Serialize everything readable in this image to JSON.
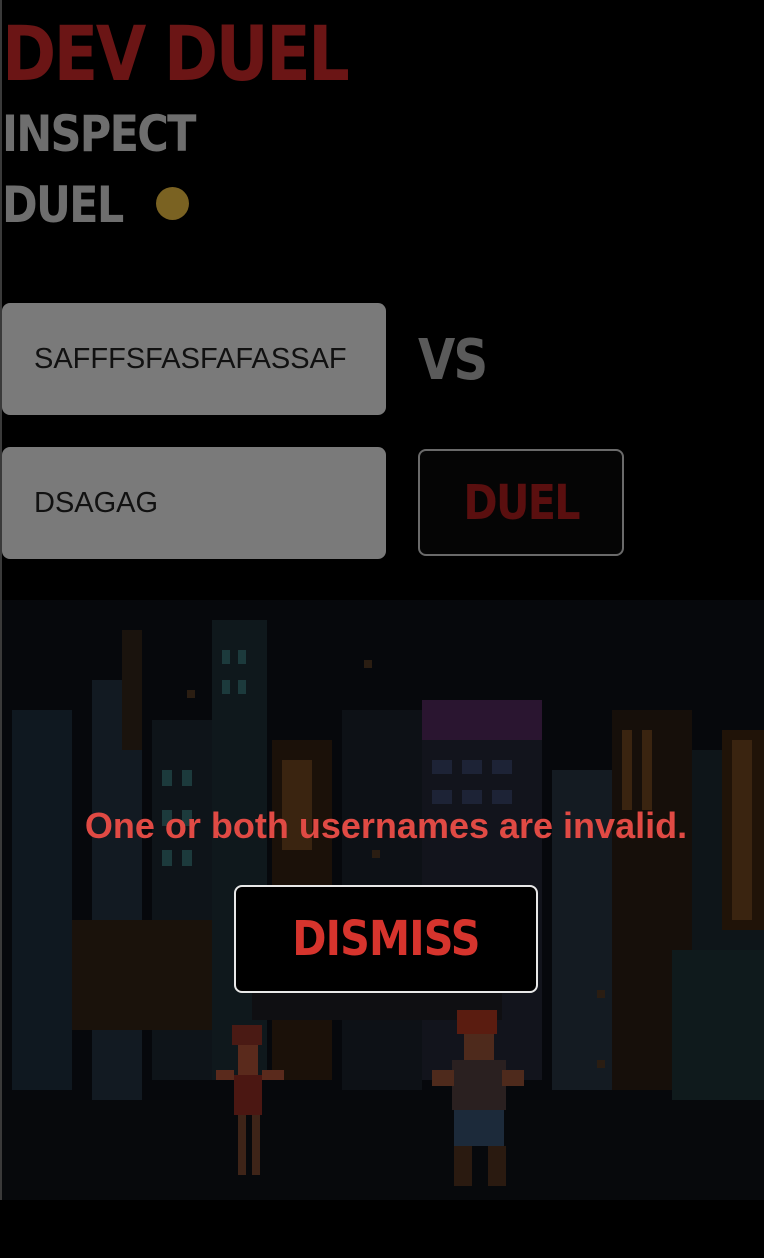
{
  "header": {
    "logo_text": "DEV DUEL"
  },
  "nav": {
    "items": [
      {
        "label": "INSPECT",
        "active": false
      },
      {
        "label": "DUEL",
        "active": true
      }
    ]
  },
  "duel_form": {
    "username_one": "SAFFFSFASFAFASSAF",
    "username_two": "DSAGAG",
    "vs_label": "VS",
    "duel_button_label": "DUEL"
  },
  "error_dialog": {
    "message": "One or both usernames are invalid.",
    "dismiss_label": "DISMISS"
  },
  "background_scene": {
    "description_icon": "pixel-city-fighters-illustration"
  },
  "colors": {
    "logo": "#6b1515",
    "nav_text": "#6e6e6e",
    "active_dot": "#7a6222",
    "input_bg": "#7a7a7a",
    "vs_text": "#5a5a5a",
    "duel_text": "#5a0f0f",
    "error_text": "#e04a44",
    "dismiss_text": "#d6342d",
    "page_bg": "#000000"
  }
}
